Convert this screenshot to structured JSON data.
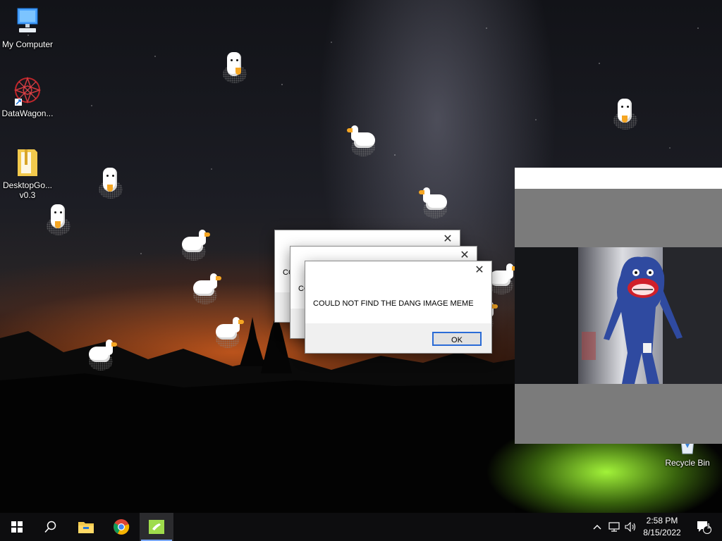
{
  "desktop": {
    "icons": [
      {
        "label": "My Computer",
        "icon": "computer-icon"
      },
      {
        "label": "DataWagon...",
        "icon": "datawagon-icon"
      },
      {
        "label": "DesktopGo... v0.3",
        "icon": "folder-zip-icon"
      },
      {
        "label": "Recycle Bin",
        "icon": "recycle-bin-icon"
      }
    ]
  },
  "dialogs": [
    {
      "message": "CO",
      "close_glyph": "✕"
    },
    {
      "message": "CO",
      "close_glyph": "✕"
    },
    {
      "message": "COULD NOT FIND THE DANG IMAGE MEME",
      "close_glyph": "✕",
      "ok_label": "OK"
    }
  ],
  "image_window": {
    "content": "huggy-wuggy-photo"
  },
  "taskbar": {
    "start_icon": "windows-logo-icon",
    "search_icon": "search-icon",
    "pinned": [
      "file-explorer-icon",
      "chrome-icon",
      "desktop-goose-icon"
    ],
    "tray": {
      "chevron": "^",
      "network_icon": "network-icon",
      "volume_icon": "volume-icon",
      "time": "2:58 PM",
      "date": "8/15/2022",
      "notifications_badge": "1"
    }
  },
  "colors": {
    "accent": "#2a6bd6",
    "goose_beak": "#f5a623",
    "tent_glow": "#aaff3c"
  }
}
